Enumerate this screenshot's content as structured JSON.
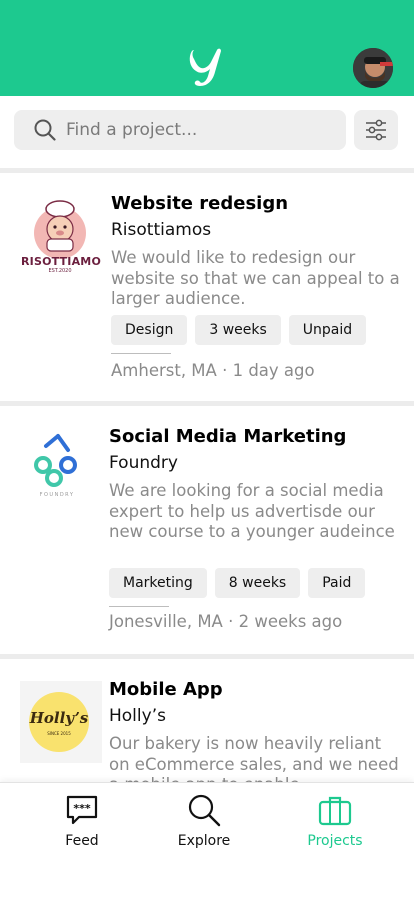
{
  "colors": {
    "accent": "#1dc98f",
    "text_muted": "#8a8a8a",
    "chip_bg": "#eeeeee"
  },
  "header": {
    "logo_icon": "brand-logo-y-icon",
    "avatar_icon": "user-avatar"
  },
  "search": {
    "placeholder": "Find a project...",
    "value": "",
    "filter_icon": "sliders-icon"
  },
  "projects": [
    {
      "title": "Website redesign",
      "company": "Risottiamos",
      "logo_text": "RISOTTIAMO",
      "logo_subtext": "EST.2020",
      "description": "We would like to redesign our website so that we can appeal to a larger audience.",
      "tags": [
        "Design",
        "3 weeks",
        "Unpaid"
      ],
      "location": "Amherst, MA",
      "posted": "1 day ago"
    },
    {
      "title": "Social Media Marketing",
      "company": "Foundry",
      "logo_text": "FOUNDRY",
      "description": "We are looking for a social media expert to help us advertisde our new course to a younger audeince",
      "tags": [
        "Marketing",
        "8 weeks",
        "Paid"
      ],
      "location": "Jonesville, MA",
      "posted": "2 weeks ago"
    },
    {
      "title": "Mobile App",
      "company": "Holly’s",
      "logo_text": "Holly’s",
      "logo_subtext": "SINCE 2015",
      "description": "Our bakery is now heavily reliant on eCommerce sales, and we need a mobile app to enable"
    }
  ],
  "separator": "·",
  "nav": {
    "items": [
      {
        "label": "Feed",
        "icon": "chat-bubble-icon",
        "active": false
      },
      {
        "label": "Explore",
        "icon": "search-icon",
        "active": false
      },
      {
        "label": "Projects",
        "icon": "briefcase-icon",
        "active": true
      }
    ]
  }
}
